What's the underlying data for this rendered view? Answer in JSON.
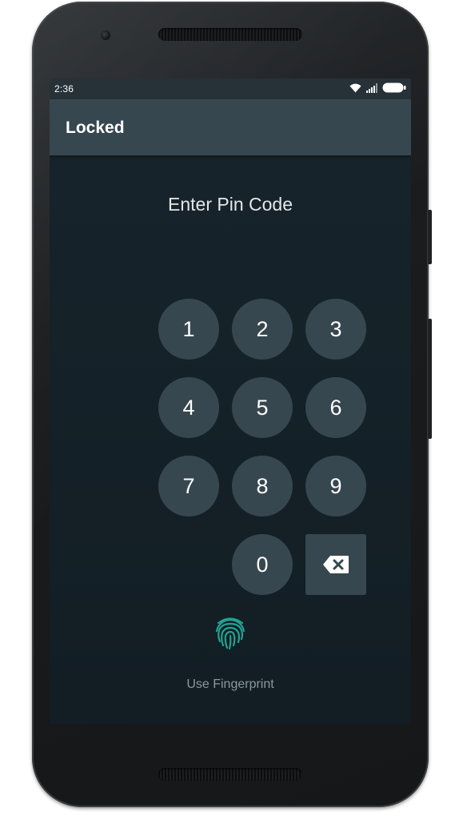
{
  "status_bar": {
    "time": "2:36",
    "icons": [
      "wifi-icon",
      "signal-icon",
      "battery-icon"
    ]
  },
  "app_bar": {
    "title": "Locked"
  },
  "pin": {
    "prompt": "Enter Pin Code",
    "keys": [
      "1",
      "2",
      "3",
      "4",
      "5",
      "6",
      "7",
      "8",
      "9",
      "0"
    ],
    "backspace_icon": "backspace-icon"
  },
  "fingerprint": {
    "icon": "fingerprint-icon",
    "label": "Use Fingerprint"
  },
  "colors": {
    "background": "#121e24",
    "app_bar": "#37474f",
    "status_bar": "#263238",
    "key": "#37474f",
    "accent": "#1fa392"
  }
}
